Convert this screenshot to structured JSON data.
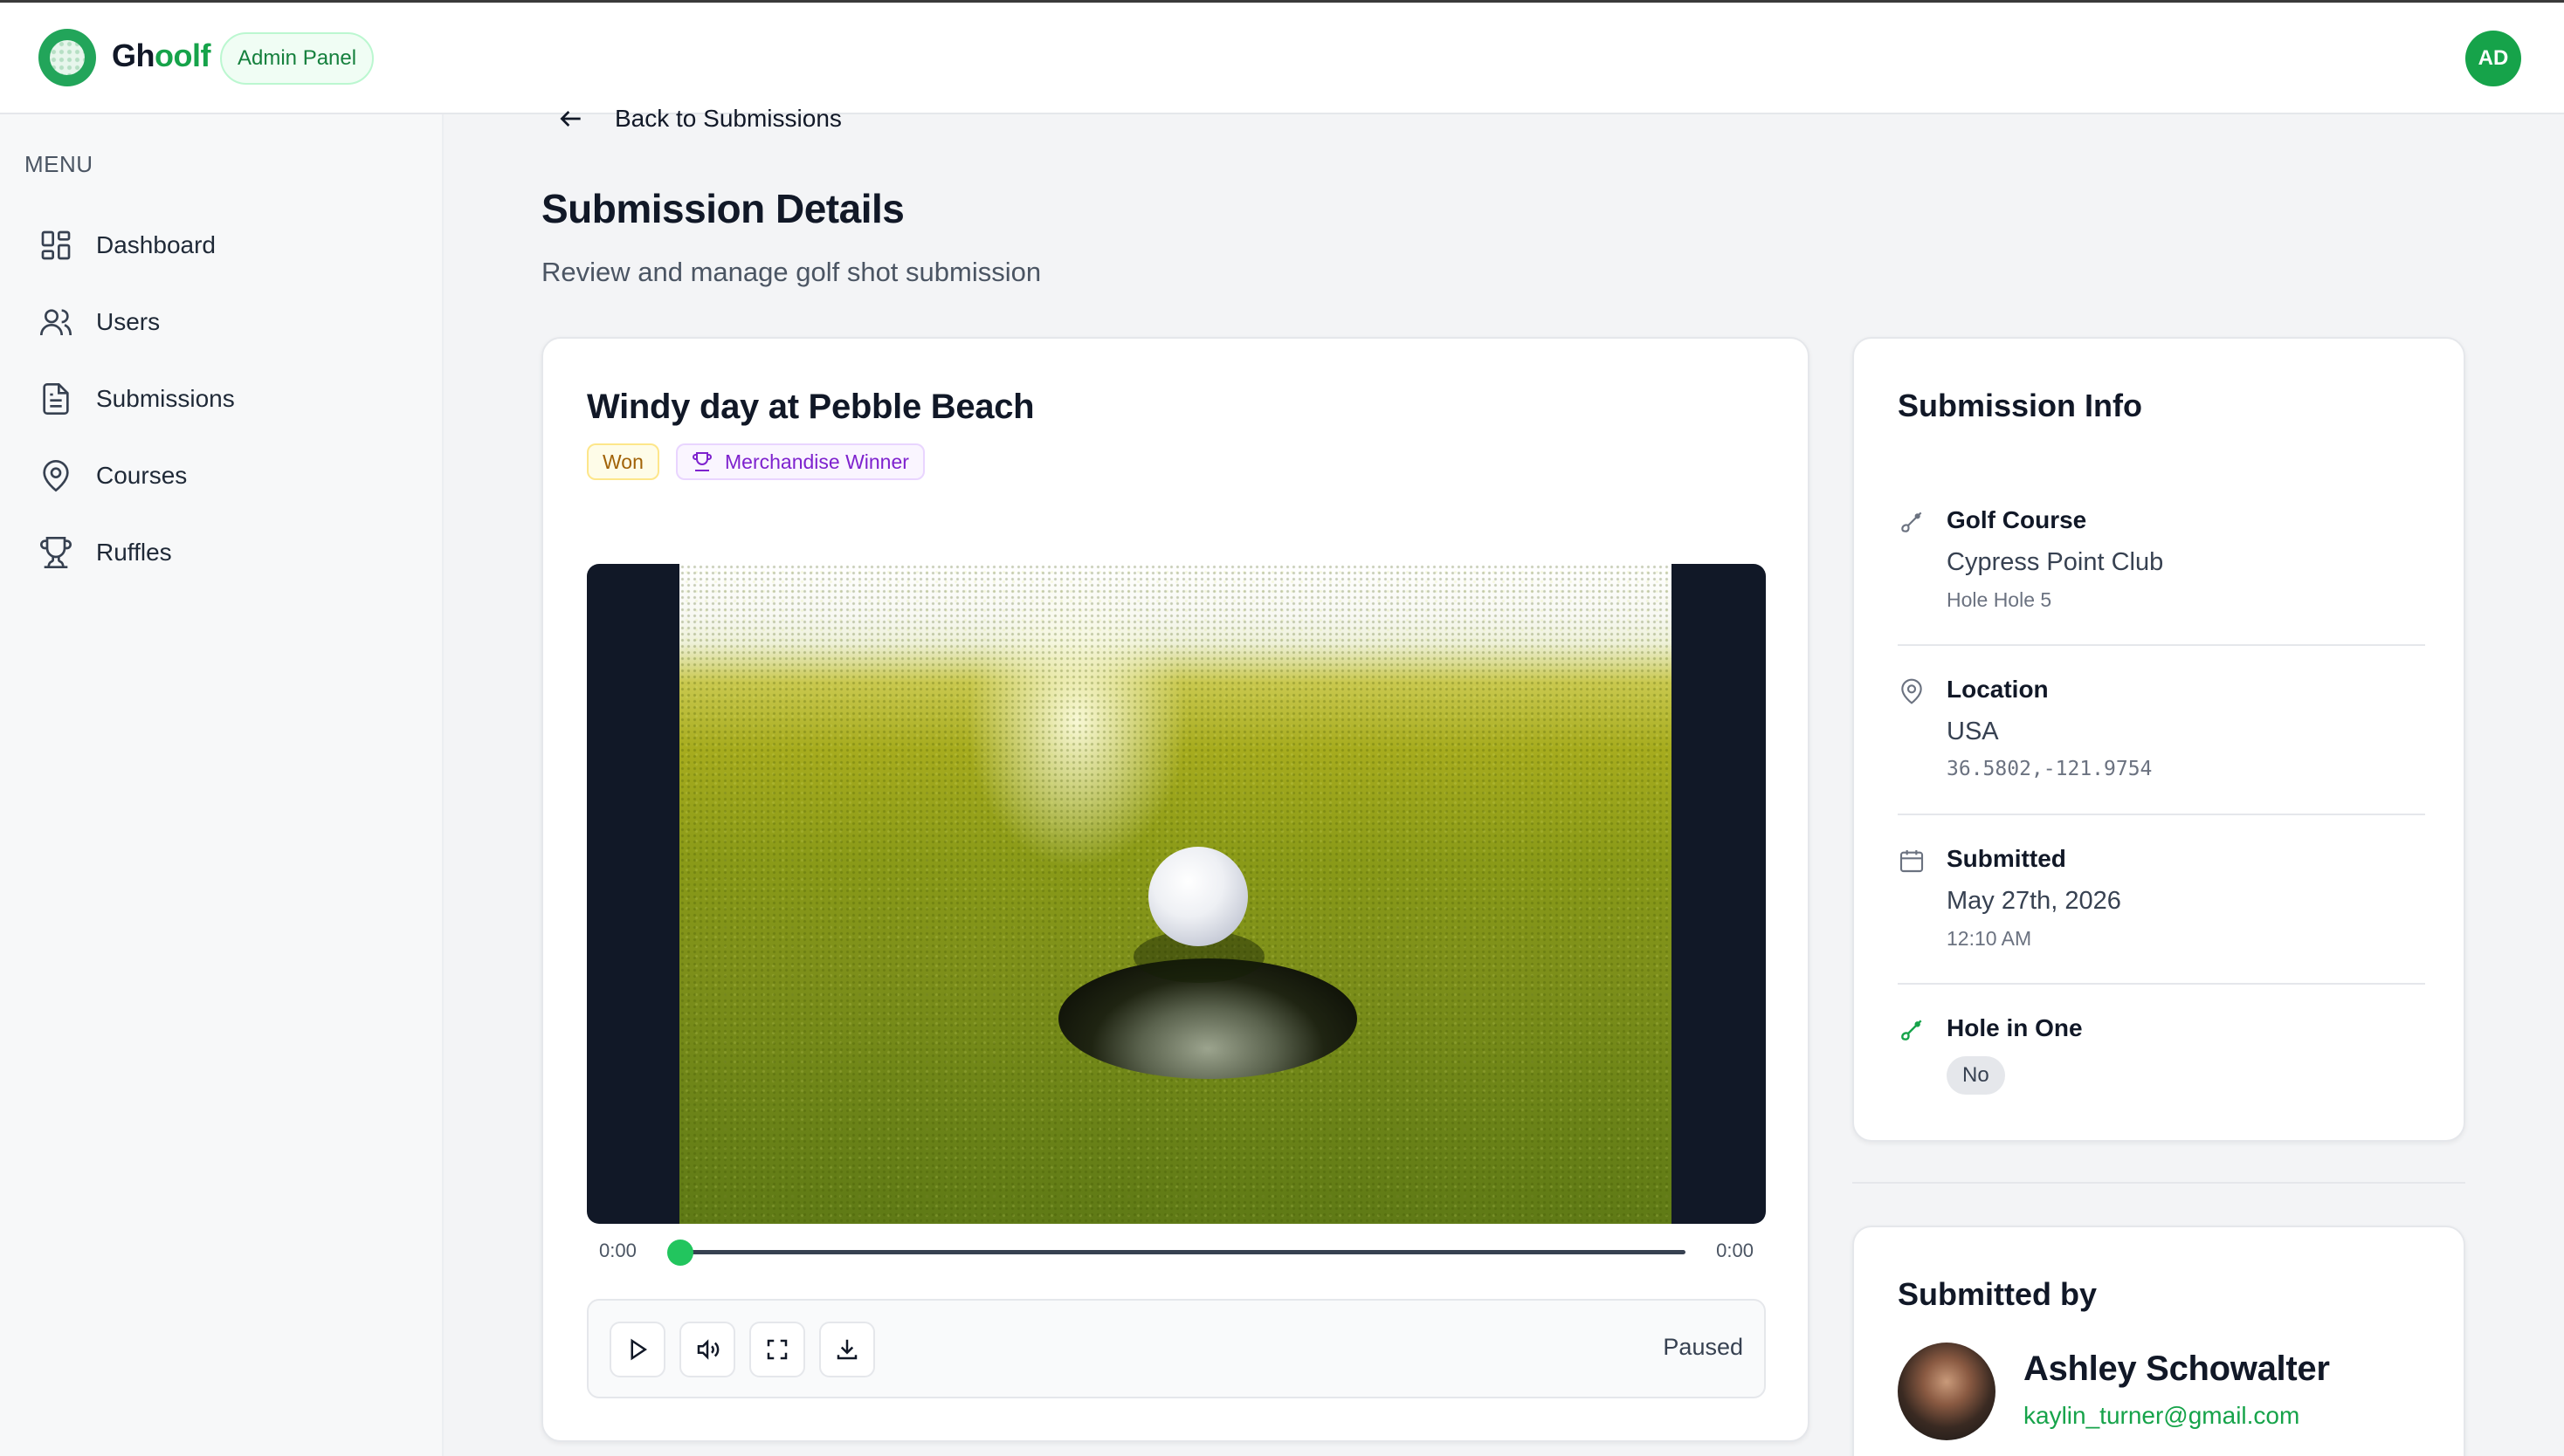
{
  "app": {
    "brand_prefix": "Gh",
    "brand_suffix": "oolf",
    "panel_badge": "Admin Panel",
    "user_initials": "AD"
  },
  "sidebar": {
    "menu_label": "MENU",
    "items": [
      {
        "label": "Dashboard",
        "icon": "dashboard-grid-icon"
      },
      {
        "label": "Users",
        "icon": "users-icon"
      },
      {
        "label": "Submissions",
        "icon": "document-icon"
      },
      {
        "label": "Courses",
        "icon": "map-pin-icon"
      },
      {
        "label": "Ruffles",
        "icon": "trophy-icon"
      }
    ]
  },
  "page": {
    "back_label": "Back to Submissions",
    "title": "Submission Details",
    "subtitle": "Review and manage golf shot submission"
  },
  "submission": {
    "title": "Windy day at Pebble Beach",
    "status_badge": "Won",
    "prize_badge": "Merchandise Winner",
    "video": {
      "current_time": "0:00",
      "duration": "0:00",
      "progress": 0,
      "state": "Paused"
    }
  },
  "info": {
    "title": "Submission Info",
    "golf_course": {
      "label": "Golf Course",
      "value": "Cypress Point Club",
      "sub": "Hole Hole 5"
    },
    "location": {
      "label": "Location",
      "value": "USA",
      "coords": "36.5802,-121.9754"
    },
    "submitted": {
      "label": "Submitted",
      "value": "May 27th, 2026",
      "time": "12:10 AM"
    },
    "hole_in_one": {
      "label": "Hole in One",
      "value": "No"
    }
  },
  "submitted_by": {
    "title": "Submitted by",
    "name": "Ashley Schowalter",
    "email": "kaylin_turner@gmail.com"
  },
  "colors": {
    "accent": "#16a34a",
    "won_badge": "#a16207",
    "prize_badge": "#7e22ce"
  }
}
